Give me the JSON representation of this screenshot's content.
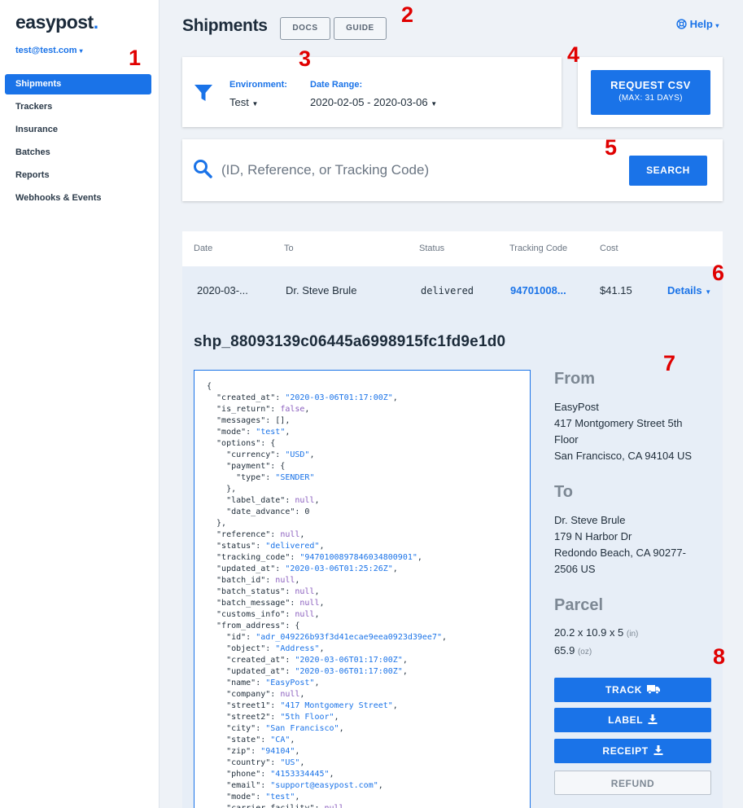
{
  "sidebar": {
    "logo": "easypost",
    "logo_dot": ".",
    "account": "test@test.com",
    "items": [
      {
        "label": "Shipments"
      },
      {
        "label": "Trackers"
      },
      {
        "label": "Insurance"
      },
      {
        "label": "Batches"
      },
      {
        "label": "Reports"
      },
      {
        "label": "Webhooks & Events"
      }
    ]
  },
  "header": {
    "title": "Shipments",
    "docs": "DOCS",
    "guide": "GUIDE",
    "help": "Help"
  },
  "filters": {
    "environment_label": "Environment:",
    "environment_value": "Test",
    "date_label": "Date Range:",
    "date_value": "2020-02-05 - 2020-03-06"
  },
  "csv": {
    "label": "REQUEST CSV",
    "sub": "(MAX: 31 DAYS)"
  },
  "search": {
    "placeholder": "(ID, Reference, or Tracking Code)",
    "button": "SEARCH"
  },
  "table": {
    "columns": [
      "Date",
      "To",
      "Status",
      "Tracking Code",
      "Cost"
    ],
    "row": {
      "date": "2020-03-...",
      "to": "Dr. Steve Brule",
      "status": "delivered",
      "tracking": "94701008...",
      "cost": "$41.15",
      "details": "Details"
    }
  },
  "shipment": {
    "id": "shp_88093139c06445a6998915fc1fd9e1d0",
    "from": {
      "heading": "From",
      "lines": [
        "EasyPost",
        "417 Montgomery Street 5th",
        "Floor",
        "San Francisco, CA 94104 US"
      ]
    },
    "to": {
      "heading": "To",
      "lines": [
        "Dr. Steve Brule",
        "179 N Harbor Dr",
        "Redondo Beach, CA 90277-",
        "2506 US"
      ]
    },
    "parcel": {
      "heading": "Parcel",
      "dims": "20.2 x 10.9 x 5",
      "dims_unit": "(in)",
      "weight": "65.9",
      "weight_unit": "(oz)"
    },
    "actions": {
      "track": "TRACK",
      "label": "LABEL",
      "receipt": "RECEIPT",
      "refund": "REFUND"
    }
  },
  "json_lines": [
    [
      [
        "{",
        ""
      ]
    ],
    [
      [
        "  \"created_at\": ",
        "k"
      ],
      [
        "\"2020-03-06T01:17:00Z\"",
        "s"
      ],
      [
        ",",
        ""
      ]
    ],
    [
      [
        "  \"is_return\": ",
        "k"
      ],
      [
        "false",
        "n"
      ],
      [
        ",",
        ""
      ]
    ],
    [
      [
        "  \"messages\": [],",
        "k"
      ]
    ],
    [
      [
        "  \"mode\": ",
        "k"
      ],
      [
        "\"test\"",
        "s"
      ],
      [
        ",",
        ""
      ]
    ],
    [
      [
        "  \"options\": {",
        "k"
      ]
    ],
    [
      [
        "    \"currency\": ",
        "k"
      ],
      [
        "\"USD\"",
        "s"
      ],
      [
        ",",
        ""
      ]
    ],
    [
      [
        "    \"payment\": {",
        "k"
      ]
    ],
    [
      [
        "      \"type\": ",
        "k"
      ],
      [
        "\"SENDER\"",
        "s"
      ]
    ],
    [
      [
        "    },",
        ""
      ]
    ],
    [
      [
        "    \"label_date\": ",
        "k"
      ],
      [
        "null",
        "n"
      ],
      [
        ",",
        ""
      ]
    ],
    [
      [
        "    \"date_advance\": 0",
        "k"
      ]
    ],
    [
      [
        "  },",
        ""
      ]
    ],
    [
      [
        "  \"reference\": ",
        "k"
      ],
      [
        "null",
        "n"
      ],
      [
        ",",
        ""
      ]
    ],
    [
      [
        "  \"status\": ",
        "k"
      ],
      [
        "\"delivered\"",
        "s"
      ],
      [
        ",",
        ""
      ]
    ],
    [
      [
        "  \"tracking_code\": ",
        "k"
      ],
      [
        "\"9470100897846034800901\"",
        "s"
      ],
      [
        ",",
        ""
      ]
    ],
    [
      [
        "  \"updated_at\": ",
        "k"
      ],
      [
        "\"2020-03-06T01:25:26Z\"",
        "s"
      ],
      [
        ",",
        ""
      ]
    ],
    [
      [
        "  \"batch_id\": ",
        "k"
      ],
      [
        "null",
        "n"
      ],
      [
        ",",
        ""
      ]
    ],
    [
      [
        "  \"batch_status\": ",
        "k"
      ],
      [
        "null",
        "n"
      ],
      [
        ",",
        ""
      ]
    ],
    [
      [
        "  \"batch_message\": ",
        "k"
      ],
      [
        "null",
        "n"
      ],
      [
        ",",
        ""
      ]
    ],
    [
      [
        "  \"customs_info\": ",
        "k"
      ],
      [
        "null",
        "n"
      ],
      [
        ",",
        ""
      ]
    ],
    [
      [
        "  \"from_address\": {",
        "k"
      ]
    ],
    [
      [
        "    \"id\": ",
        "k"
      ],
      [
        "\"adr_049226b93f3d41ecae9eea0923d39ee7\"",
        "s"
      ],
      [
        ",",
        ""
      ]
    ],
    [
      [
        "    \"object\": ",
        "k"
      ],
      [
        "\"Address\"",
        "s"
      ],
      [
        ",",
        ""
      ]
    ],
    [
      [
        "    \"created_at\": ",
        "k"
      ],
      [
        "\"2020-03-06T01:17:00Z\"",
        "s"
      ],
      [
        ",",
        ""
      ]
    ],
    [
      [
        "    \"updated_at\": ",
        "k"
      ],
      [
        "\"2020-03-06T01:17:00Z\"",
        "s"
      ],
      [
        ",",
        ""
      ]
    ],
    [
      [
        "    \"name\": ",
        "k"
      ],
      [
        "\"EasyPost\"",
        "s"
      ],
      [
        ",",
        ""
      ]
    ],
    [
      [
        "    \"company\": ",
        "k"
      ],
      [
        "null",
        "n"
      ],
      [
        ",",
        ""
      ]
    ],
    [
      [
        "    \"street1\": ",
        "k"
      ],
      [
        "\"417 Montgomery Street\"",
        "s"
      ],
      [
        ",",
        ""
      ]
    ],
    [
      [
        "    \"street2\": ",
        "k"
      ],
      [
        "\"5th Floor\"",
        "s"
      ],
      [
        ",",
        ""
      ]
    ],
    [
      [
        "    \"city\": ",
        "k"
      ],
      [
        "\"San Francisco\"",
        "s"
      ],
      [
        ",",
        ""
      ]
    ],
    [
      [
        "    \"state\": ",
        "k"
      ],
      [
        "\"CA\"",
        "s"
      ],
      [
        ",",
        ""
      ]
    ],
    [
      [
        "    \"zip\": ",
        "k"
      ],
      [
        "\"94104\"",
        "s"
      ],
      [
        ",",
        ""
      ]
    ],
    [
      [
        "    \"country\": ",
        "k"
      ],
      [
        "\"US\"",
        "s"
      ],
      [
        ",",
        ""
      ]
    ],
    [
      [
        "    \"phone\": ",
        "k"
      ],
      [
        "\"4153334445\"",
        "s"
      ],
      [
        ",",
        ""
      ]
    ],
    [
      [
        "    \"email\": ",
        "k"
      ],
      [
        "\"support@easypost.com\"",
        "s"
      ],
      [
        ",",
        ""
      ]
    ],
    [
      [
        "    \"mode\": ",
        "k"
      ],
      [
        "\"test\"",
        "s"
      ],
      [
        ",",
        ""
      ]
    ],
    [
      [
        "    \"carrier_facility\": ",
        "k"
      ],
      [
        "null",
        "n"
      ],
      [
        ",",
        ""
      ]
    ]
  ],
  "markers": [
    "1",
    "2",
    "3",
    "4",
    "5",
    "6",
    "7",
    "8"
  ],
  "colors": {
    "accent": "#1a73e8",
    "marker": "#e00000",
    "row_bg": "#e7eef7",
    "page_bg": "#eef2f7"
  },
  "icons": {
    "filter": "filter-icon",
    "search": "magnifier-icon",
    "help": "globe-help-icon",
    "truck": "truck-icon",
    "download": "download-icon"
  }
}
